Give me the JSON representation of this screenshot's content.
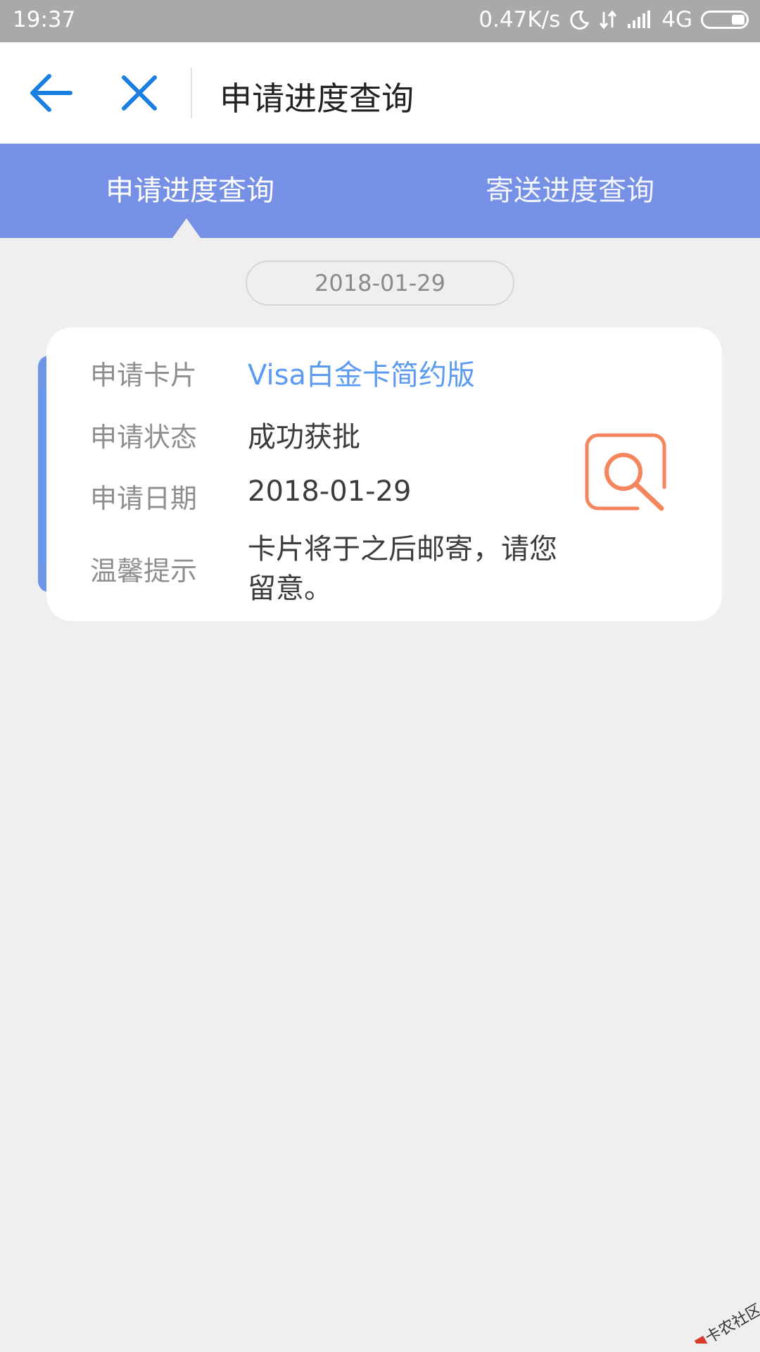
{
  "status_bar": {
    "time": "19:37",
    "net_speed": "0.47K/s",
    "network": "4G",
    "icons": [
      "moon-icon",
      "data-transfer-icon",
      "signal-icon",
      "battery-icon"
    ]
  },
  "header": {
    "title": "申请进度查询",
    "icons": [
      "back-arrow-icon",
      "close-icon"
    ]
  },
  "tabs": [
    {
      "label": "申请进度查询",
      "active": true
    },
    {
      "label": "寄送进度查询",
      "active": false
    }
  ],
  "date": "2018-01-29",
  "card": {
    "rows": [
      {
        "label": "申请卡片",
        "value": "Visa白金卡简约版"
      },
      {
        "label": "申请状态",
        "value": "成功获批"
      },
      {
        "label": "申请日期",
        "value": "2018-01-29"
      },
      {
        "label": "温馨提示",
        "value": "卡片将于之后邮寄，请您留意。"
      }
    ],
    "action_icon": "search-icon"
  },
  "watermark": "卡农社区",
  "colors": {
    "tab_bar": "#7590e4",
    "accent_blue": "#1a7fe0",
    "link_blue": "#5b9af2",
    "icon_orange": "#f5855c",
    "background": "#efefef"
  }
}
